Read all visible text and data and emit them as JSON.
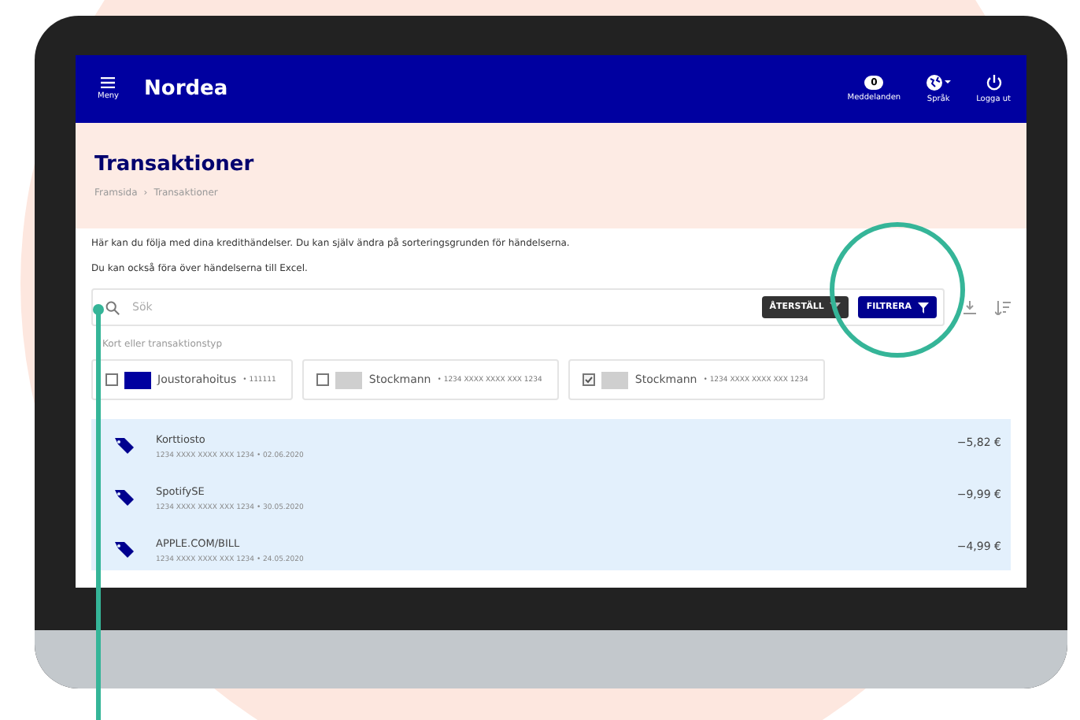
{
  "header": {
    "menu_label": "Meny",
    "logo": "Nordea",
    "actions": [
      {
        "kind": "messages",
        "badge": "0",
        "label": "Meddelanden"
      },
      {
        "kind": "language",
        "label": "Språk"
      },
      {
        "kind": "logout",
        "label": "Logga ut"
      }
    ]
  },
  "page": {
    "title": "Transaktioner",
    "breadcrumb": [
      "Framsida",
      "Transaktioner"
    ],
    "breadcrumb_separator": "›"
  },
  "intro": [
    "Här kan du följa med dina kredithändelser. Du kan själv ändra på sorteringsgrunden för händelserna.",
    "Du kan också föra över händelserna till Excel."
  ],
  "search": {
    "placeholder": "Sök",
    "reset_button": "ÅTERSTÄLL",
    "filter_button": "FILTRERA"
  },
  "card_filter": {
    "label": "Kort eller transaktionstyp",
    "cards": [
      {
        "name": "Joustorahoitus",
        "number": "• 111111",
        "checked": false,
        "kind": "blue"
      },
      {
        "name": "Stockmann",
        "number": "• 1234 XXXX XXXX XXX 1234",
        "checked": false,
        "kind": "grey"
      },
      {
        "name": "Stockmann",
        "number": "• 1234 XXXX XXXX XXX 1234",
        "checked": true,
        "kind": "grey"
      }
    ]
  },
  "transactions": [
    {
      "title": "Korttiosto",
      "detail": "1234 XXXX XXXX XXX 1234 • 02.06.2020",
      "amount": "−5,82 €"
    },
    {
      "title": "SpotifySE",
      "detail": "1234 XXXX XXXX XXX 1234 • 30.05.2020",
      "amount": "−9,99 €"
    },
    {
      "title": "APPLE.COM/BILL",
      "detail": "1234 XXXX XXXX XXX 1234 • 24.05.2020",
      "amount": "−4,99 €"
    }
  ]
}
